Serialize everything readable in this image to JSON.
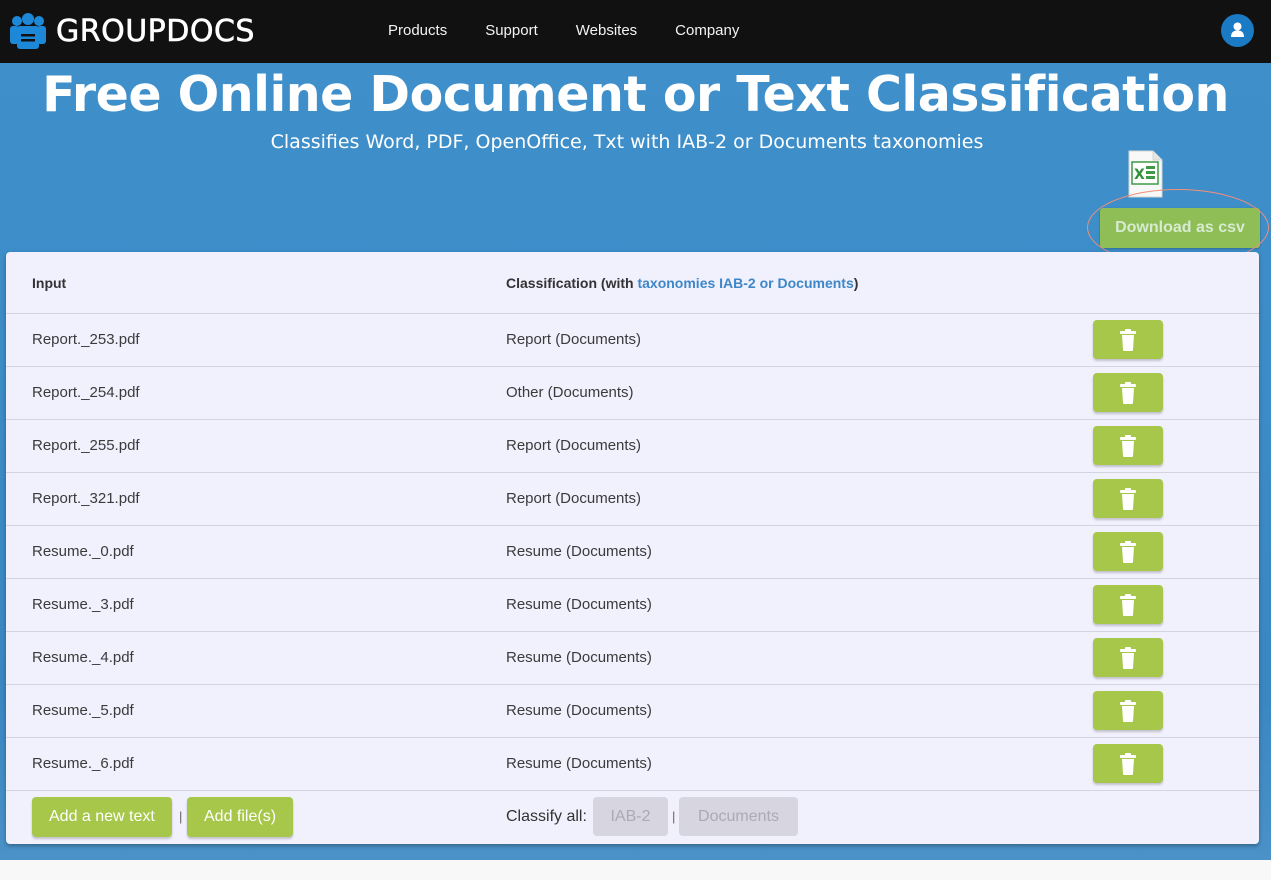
{
  "header": {
    "brand": "GROUPDOCS",
    "nav": [
      "Products",
      "Support",
      "Websites",
      "Company"
    ]
  },
  "hero": {
    "title": "Free Online Document or Text Classification",
    "subtitle": "Classifies Word, PDF, OpenOffice, Txt with IAB-2 or Documents taxonomies",
    "download_label": "Download as csv"
  },
  "table": {
    "col_input": "Input",
    "col_classification_prefix": "Classification (with ",
    "col_classification_link": "taxonomies IAB-2 or Documents",
    "col_classification_suffix": ")",
    "rows": [
      {
        "input": "Report._253.pdf",
        "classification": "Report (Documents)"
      },
      {
        "input": "Report._254.pdf",
        "classification": "Other (Documents)"
      },
      {
        "input": "Report._255.pdf",
        "classification": "Report (Documents)"
      },
      {
        "input": "Report._321.pdf",
        "classification": "Report (Documents)"
      },
      {
        "input": "Resume._0.pdf",
        "classification": "Resume (Documents)"
      },
      {
        "input": "Resume._3.pdf",
        "classification": "Resume (Documents)"
      },
      {
        "input": "Resume._4.pdf",
        "classification": "Resume (Documents)"
      },
      {
        "input": "Resume._5.pdf",
        "classification": "Resume (Documents)"
      },
      {
        "input": "Resume._6.pdf",
        "classification": "Resume (Documents)"
      }
    ]
  },
  "footer": {
    "add_text_label": "Add a new text",
    "separator": "|",
    "add_files_label": "Add file(s)",
    "classify_all_label": "Classify all:",
    "iab2_label": "IAB-2",
    "documents_label": "Documents"
  },
  "colors": {
    "brand_blue": "#3b8cc8",
    "action_green": "#a6c74a",
    "link_blue": "#3d87c8",
    "highlight": "#f0907a"
  }
}
